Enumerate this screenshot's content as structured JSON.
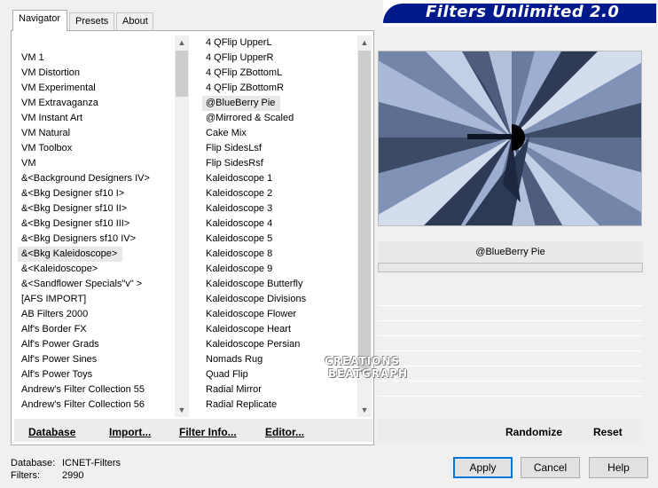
{
  "tabs": [
    "Navigator",
    "Presets",
    "About"
  ],
  "banner_title": "Filters Unlimited 2.0",
  "categories": [
    "VM 1",
    "VM Distortion",
    "VM Experimental",
    "VM Extravaganza",
    "VM Instant Art",
    "VM Natural",
    "VM Toolbox",
    "VM",
    "&<Background Designers IV>",
    "&<Bkg Designer sf10 I>",
    "&<Bkg Designer sf10 II>",
    "&<Bkg Designer sf10 III>",
    "&<Bkg Designers sf10 IV>",
    "&<Bkg Kaleidoscope>",
    "&<Kaleidoscope>",
    "&<Sandflower Specials\"v\" >",
    "[AFS IMPORT]",
    "AB Filters 2000",
    "Alf's Border FX",
    "Alf's Power Grads",
    "Alf's Power Sines",
    "Alf's Power Toys",
    "Andrew's Filter Collection 55",
    "Andrew's Filter Collection 56"
  ],
  "selected_category_index": 13,
  "filters": [
    "4 QFlip UpperL",
    "4 QFlip UpperR",
    "4 QFlip ZBottomL",
    "4 QFlip ZBottomR",
    "@BlueBerry Pie",
    "@Mirrored & Scaled",
    "Cake Mix",
    "Flip SidesLsf",
    "Flip SidesRsf",
    "Kaleidoscope 1",
    "Kaleidoscope 2",
    "Kaleidoscope 3",
    "Kaleidoscope 4",
    "Kaleidoscope 5",
    "Kaleidoscope 8",
    "Kaleidoscope 9",
    "Kaleidoscope Butterfly",
    "Kaleidoscope Divisions",
    "Kaleidoscope Flower",
    "Kaleidoscope Heart",
    "Kaleidoscope Persian",
    "Nomads Rug",
    "Quad Flip",
    "Radial Mirror",
    "Radial Replicate"
  ],
  "selected_filter_index": 4,
  "panel_buttons": {
    "database": "Database",
    "import": "Import...",
    "filter_info": "Filter Info...",
    "editor": "Editor..."
  },
  "selected_filter_name": "@BlueBerry Pie",
  "right_buttons": {
    "randomize": "Randomize",
    "reset": "Reset"
  },
  "status": {
    "database_label": "Database:",
    "database_value": "ICNET-Filters",
    "filters_label": "Filters:",
    "filters_value": "2990"
  },
  "dialog_buttons": {
    "apply": "Apply",
    "cancel": "Cancel",
    "help": "Help"
  },
  "watermark": [
    "CREATIONS",
    "BEATGRAPH"
  ],
  "colors": {
    "banner_blue": "#001a8c",
    "preview_base": "#8fa2c8",
    "accent": "#0078d7"
  }
}
